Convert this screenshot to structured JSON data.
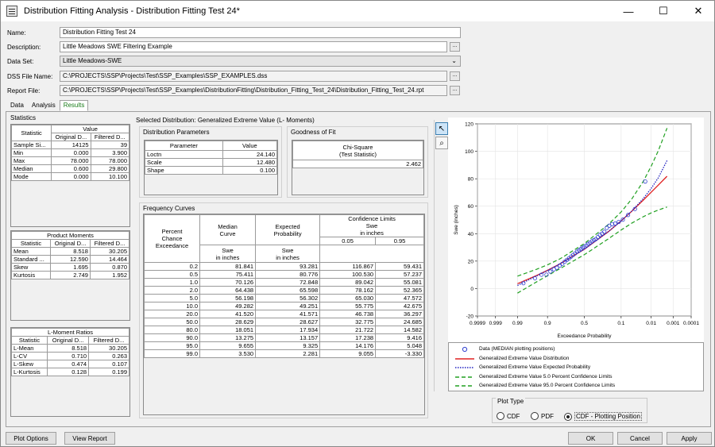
{
  "window": {
    "title": "Distribution Fitting Analysis - Distribution Fitting Test 24*"
  },
  "form": {
    "name_label": "Name:",
    "name_value": "Distribution Fitting Test 24",
    "desc_label": "Description:",
    "desc_value": "Little Meadows SWE Filtering Example",
    "dataset_label": "Data Set:",
    "dataset_value": "Little Meadows-SWE",
    "dss_label": "DSS File Name:",
    "dss_value": "C:\\PROJECTS\\SSP\\Projects\\Test\\SSP_Examples\\SSP_EXAMPLES.dss",
    "report_label": "Report File:",
    "report_value": "C:\\PROJECTS\\SSP\\Projects\\Test\\SSP_Examples\\DistributionFitting\\Distribution_Fitting_Test_24\\Distribution_Fitting_Test_24.rpt"
  },
  "tabs": [
    "Data",
    "Analysis",
    "Results"
  ],
  "statistics": {
    "title": "Statistics",
    "h_stat": "Statistic",
    "h_value": "Value",
    "h_orig": "Original D...",
    "h_filt": "Filtered D...",
    "rows": [
      [
        "Sample Si...",
        "14125",
        "39"
      ],
      [
        "Min",
        "0.000",
        "3.900"
      ],
      [
        "Max",
        "78.000",
        "78.000"
      ],
      [
        "Median",
        "0.600",
        "29.800"
      ],
      [
        "Mode",
        "0.000",
        "10.100"
      ]
    ]
  },
  "product_moments": {
    "title": "Product Moments",
    "h_stat": "Statistic",
    "h_orig": "Original D...",
    "h_filt": "Filtered D...",
    "rows": [
      [
        "Mean",
        "8.518",
        "30.205"
      ],
      [
        "Standard ...",
        "12.590",
        "14.464"
      ],
      [
        "Skew",
        "1.695",
        "0.870"
      ],
      [
        "Kurtosis",
        "2.749",
        "1.952"
      ]
    ]
  },
  "lmoments": {
    "title": "L-Moment Ratios",
    "h_stat": "Statistic",
    "h_orig": "Original D...",
    "h_filt": "Filtered D...",
    "rows": [
      [
        "L-Mean",
        "8.518",
        "30.205"
      ],
      [
        "L-CV",
        "0.710",
        "0.263"
      ],
      [
        "L-Skew",
        "0.474",
        "0.107"
      ],
      [
        "L-Kurtosis",
        "0.128",
        "0.199"
      ]
    ]
  },
  "selected_dist": "Selected Distribution: Generalized Extreme Value (L- Moments)",
  "dist_params": {
    "title": "Distribution Parameters",
    "h_param": "Parameter",
    "h_value": "Value",
    "rows": [
      [
        "Loctn",
        "24.140"
      ],
      [
        "Scale",
        "12.480"
      ],
      [
        "Shape",
        "0.100"
      ]
    ]
  },
  "gof": {
    "title": "Goodness of Fit",
    "h1": "Chi-Square",
    "h2": "(Test Statistic)",
    "value": "2.462"
  },
  "freq": {
    "title": "Frequency Curves",
    "h_pce1": "Percent",
    "h_pce2": "Chance",
    "h_pce3": "Exceedance",
    "h_median1": "Median",
    "h_median2": "Curve",
    "h_median3": "Swe",
    "h_median4": "in inches",
    "h_exp1": "Expected",
    "h_exp2": "Probability",
    "h_exp3": "Swe",
    "h_exp4": "in inches",
    "h_cl1": "Confidence Limits",
    "h_cl2": "Swe",
    "h_cl3": "in inches",
    "h_cl_a": "0.05",
    "h_cl_b": "0.95",
    "rows": [
      [
        "0.2",
        "81.841",
        "93.281",
        "116.867",
        "59.431"
      ],
      [
        "0.5",
        "75.411",
        "80.776",
        "100.530",
        "57.237"
      ],
      [
        "1.0",
        "70.126",
        "72.848",
        "89.042",
        "55.081"
      ],
      [
        "2.0",
        "64.438",
        "65.598",
        "78.162",
        "52.365"
      ],
      [
        "5.0",
        "56.198",
        "56.302",
        "65.030",
        "47.572"
      ],
      [
        "10.0",
        "49.282",
        "49.251",
        "55.775",
        "42.675"
      ],
      [
        "20.0",
        "41.520",
        "41.571",
        "46.738",
        "36.297"
      ],
      [
        "50.0",
        "28.629",
        "28.627",
        "32.775",
        "24.685"
      ],
      [
        "80.0",
        "18.051",
        "17.934",
        "21.722",
        "14.582"
      ],
      [
        "90.0",
        "13.275",
        "13.157",
        "17.238",
        "9.416"
      ],
      [
        "95.0",
        "9.655",
        "9.325",
        "14.176",
        "5.048"
      ],
      [
        "99.0",
        "3.530",
        "2.281",
        "9.055",
        "-3.330"
      ]
    ]
  },
  "chart_data": {
    "type": "line",
    "xlabel": "Exceedance Probability",
    "ylabel": "Swe (inches)",
    "x_scale": "normal probability (reversed)",
    "x_ticks": [
      "0.9999",
      "0.999",
      "0.99",
      "0.9",
      "0.5",
      "0.1",
      "0.01",
      "0.001",
      "0.0001"
    ],
    "ylim": [
      -20,
      120
    ],
    "y_ticks": [
      "-20",
      "0",
      "20",
      "40",
      "60",
      "80",
      "100",
      "120"
    ],
    "grid": true,
    "series": [
      {
        "name": "Generalized Extreme Value Distribution",
        "color": "#e02020",
        "x": [
          0.99,
          0.95,
          0.9,
          0.8,
          0.5,
          0.2,
          0.1,
          0.05,
          0.02,
          0.01,
          0.005,
          0.002
        ],
        "y": [
          3.53,
          9.655,
          13.275,
          18.051,
          28.629,
          41.52,
          49.282,
          56.198,
          64.438,
          70.126,
          75.411,
          81.841
        ]
      },
      {
        "name": "Generalized Extreme Value Expected Probability",
        "color": "#2020c0",
        "x": [
          0.99,
          0.95,
          0.9,
          0.8,
          0.5,
          0.2,
          0.1,
          0.05,
          0.02,
          0.01,
          0.005,
          0.002
        ],
        "y": [
          2.281,
          9.325,
          13.157,
          17.934,
          28.627,
          41.571,
          49.251,
          56.302,
          65.598,
          72.848,
          80.776,
          93.281
        ]
      },
      {
        "name": "Generalized Extreme Value 5.0 Percent Confidence Limits",
        "color": "#20a020",
        "x": [
          0.99,
          0.95,
          0.9,
          0.8,
          0.5,
          0.2,
          0.1,
          0.05,
          0.02,
          0.01,
          0.005,
          0.002
        ],
        "y": [
          9.055,
          14.176,
          17.238,
          21.722,
          32.775,
          46.738,
          55.775,
          65.03,
          78.162,
          89.042,
          100.53,
          116.867
        ]
      },
      {
        "name": "Generalized Extreme Value 95.0 Percent Confidence Limits",
        "color": "#20a020",
        "x": [
          0.99,
          0.95,
          0.9,
          0.8,
          0.5,
          0.2,
          0.1,
          0.05,
          0.02,
          0.01,
          0.005,
          0.002
        ],
        "y": [
          -3.33,
          5.048,
          9.416,
          14.582,
          24.685,
          36.297,
          42.675,
          47.572,
          52.365,
          55.081,
          57.237,
          59.431
        ]
      },
      {
        "name": "Data (MEDIAN plotting positions)",
        "color": "#3040d0",
        "x": [
          0.983,
          0.957,
          0.932,
          0.906,
          0.881,
          0.855,
          0.83,
          0.804,
          0.779,
          0.753,
          0.728,
          0.702,
          0.677,
          0.651,
          0.626,
          0.6,
          0.574,
          0.549,
          0.523,
          0.498,
          0.472,
          0.447,
          0.421,
          0.396,
          0.37,
          0.345,
          0.319,
          0.294,
          0.268,
          0.243,
          0.217,
          0.192,
          0.166,
          0.141,
          0.115,
          0.09,
          0.064,
          0.039,
          0.017
        ],
        "y": [
          3.9,
          7.5,
          10.1,
          10.1,
          12.4,
          14.0,
          15.2,
          16.8,
          18.0,
          19.5,
          20.9,
          22.1,
          23.3,
          24.5,
          25.6,
          26.9,
          27.8,
          28.8,
          29.8,
          30.5,
          31.4,
          32.6,
          33.4,
          34.5,
          35.3,
          36.0,
          37.5,
          39.1,
          40.0,
          41.4,
          44.2,
          45.8,
          46.9,
          47.4,
          48.6,
          50.2,
          53.6,
          58.0,
          78.0
        ]
      }
    ]
  },
  "legend": [
    "Data (MEDIAN plotting positions)",
    "Generalized Extreme Value Distribution",
    "Generalized Extreme Value Expected Probability",
    "Generalized Extreme Value 5.0 Percent Confidence Limits",
    "Generalized Extreme Value 95.0 Percent Confidence Limits"
  ],
  "plot_type": {
    "title": "Plot Type",
    "opt1": "CDF",
    "opt2": "PDF",
    "opt3": "CDF - Plotting Position",
    "selected": "CDF - Plotting Position"
  },
  "buttons": {
    "plot_options": "Plot Options",
    "view_report": "View Report",
    "ok": "OK",
    "cancel": "Cancel",
    "apply": "Apply"
  }
}
